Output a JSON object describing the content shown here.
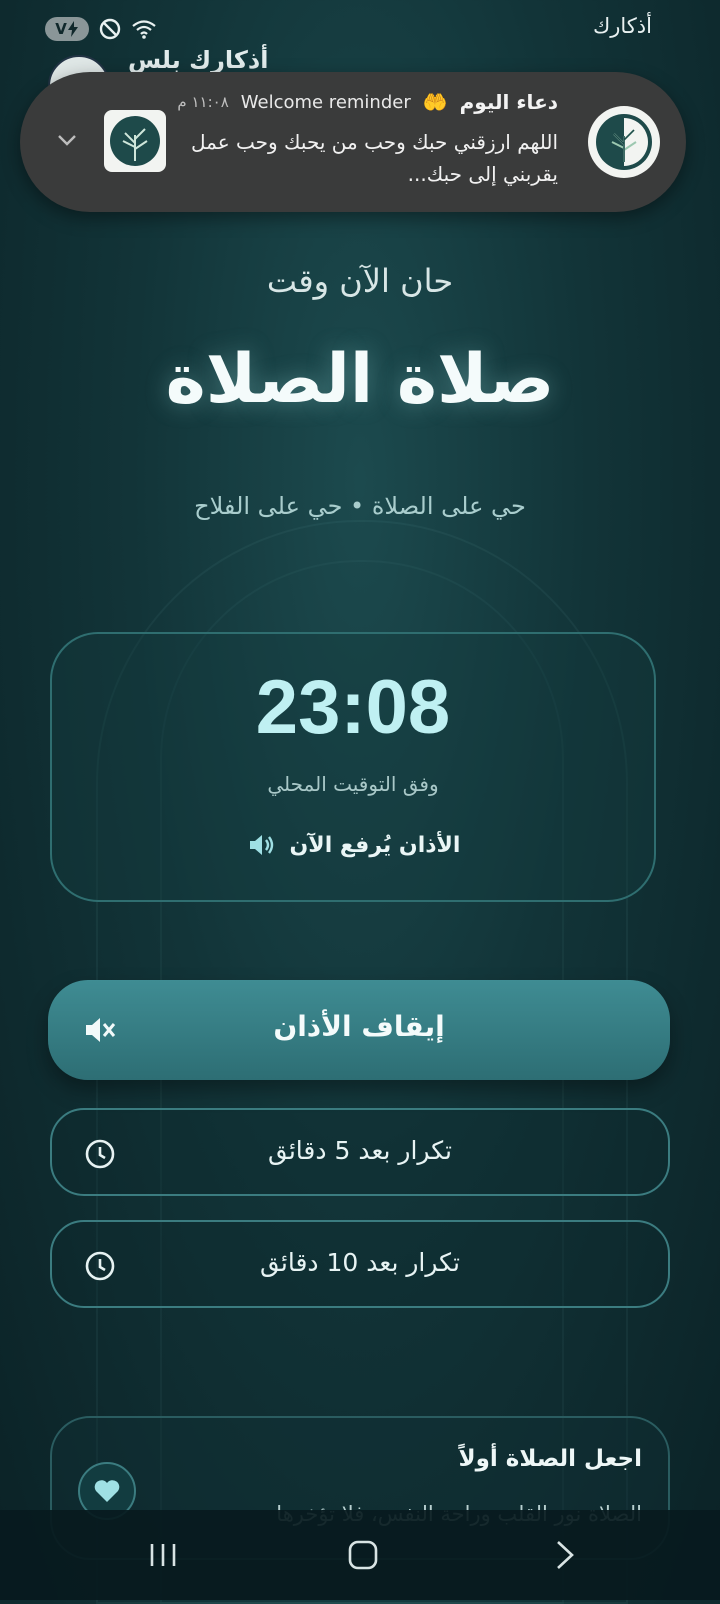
{
  "status_bar": {
    "battery_label": "V",
    "carrier": "أذكارك",
    "colors": {
      "pill": "#8a9698"
    }
  },
  "background_app": {
    "title": "أذكارك بلس"
  },
  "notification": {
    "title": "دعاء اليوم",
    "emoji": "🤲",
    "channel": "Welcome reminder",
    "time": "١١:٠٨ م",
    "body": "اللهم ارزقني حبك وحب من يحبك وحب عمل يقربني إلى حبك...",
    "icons": [
      "tree-logo-icon",
      "tree-thumbnail-icon",
      "chevron-down-icon"
    ]
  },
  "screen": {
    "subtitle": "حان الآن وقت",
    "prayer_title": "صلاة الصلاة",
    "tagline": "حي على الصلاة • حي على الفلاح",
    "clock": "23:08",
    "clock_sub": "وفق التوقيت المحلي",
    "adhan_status": "الأذان يُرفع الآن",
    "stop_button": "إيقاف الأذان",
    "snooze_5": "تكرار بعد 5 دقائق",
    "snooze_10": "تكرار بعد 10 دقائق",
    "info_title": "اجعل الصلاة أولاً",
    "info_text": "الصلاة نور القلب وراحة النفس، فلا تؤخرها",
    "accent": "#3f8c93"
  },
  "nav": {
    "icons": [
      "recent-apps-icon",
      "home-icon",
      "back-icon"
    ]
  }
}
